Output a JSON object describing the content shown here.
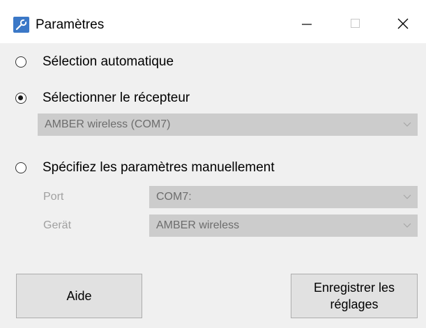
{
  "window": {
    "title": "Paramètres"
  },
  "options": {
    "auto": {
      "label": "Sélection automatique",
      "checked": false
    },
    "receiver": {
      "label": "Sélectionner le récepteur",
      "checked": true,
      "value": "AMBER wireless (COM7)"
    },
    "manual": {
      "label": "Spécifiez les paramètres manuellement",
      "checked": false
    }
  },
  "manual_fields": {
    "port_label": "Port",
    "port_value": "COM7:",
    "device_label": "Gerät",
    "device_value": "AMBER wireless"
  },
  "buttons": {
    "help": "Aide",
    "save": "Enregistrer les réglages"
  },
  "icons": {
    "app": "settings-icon",
    "minimize": "minimize-icon",
    "maximize": "maximize-icon",
    "close": "close-icon"
  }
}
